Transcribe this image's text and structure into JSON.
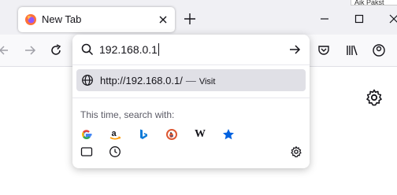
{
  "tab": {
    "title": "New Tab"
  },
  "window_hint": {
    "text": "Aik Pakst"
  },
  "urlbar": {
    "value": "192.168.0.1"
  },
  "result": {
    "url": "http://192.168.0.1/",
    "separator": "—",
    "action": "Visit"
  },
  "one_off": {
    "label": "This time, search with:",
    "engines": [
      "google-icon",
      "amazon-icon",
      "bing-icon",
      "duckduckgo-icon",
      "wikipedia-icon",
      "star-icon"
    ],
    "wikipedia_text": "W"
  },
  "colors": {
    "firefox": "#ff7139",
    "google_blue": "#4285f4",
    "google_red": "#ea4335",
    "google_yellow": "#fbbc05",
    "google_green": "#34a853",
    "amazon_orange": "#ff9900",
    "bing_blue": "#0f7bd8",
    "duckduckgo": "#de5833",
    "star": "#0061e0"
  }
}
